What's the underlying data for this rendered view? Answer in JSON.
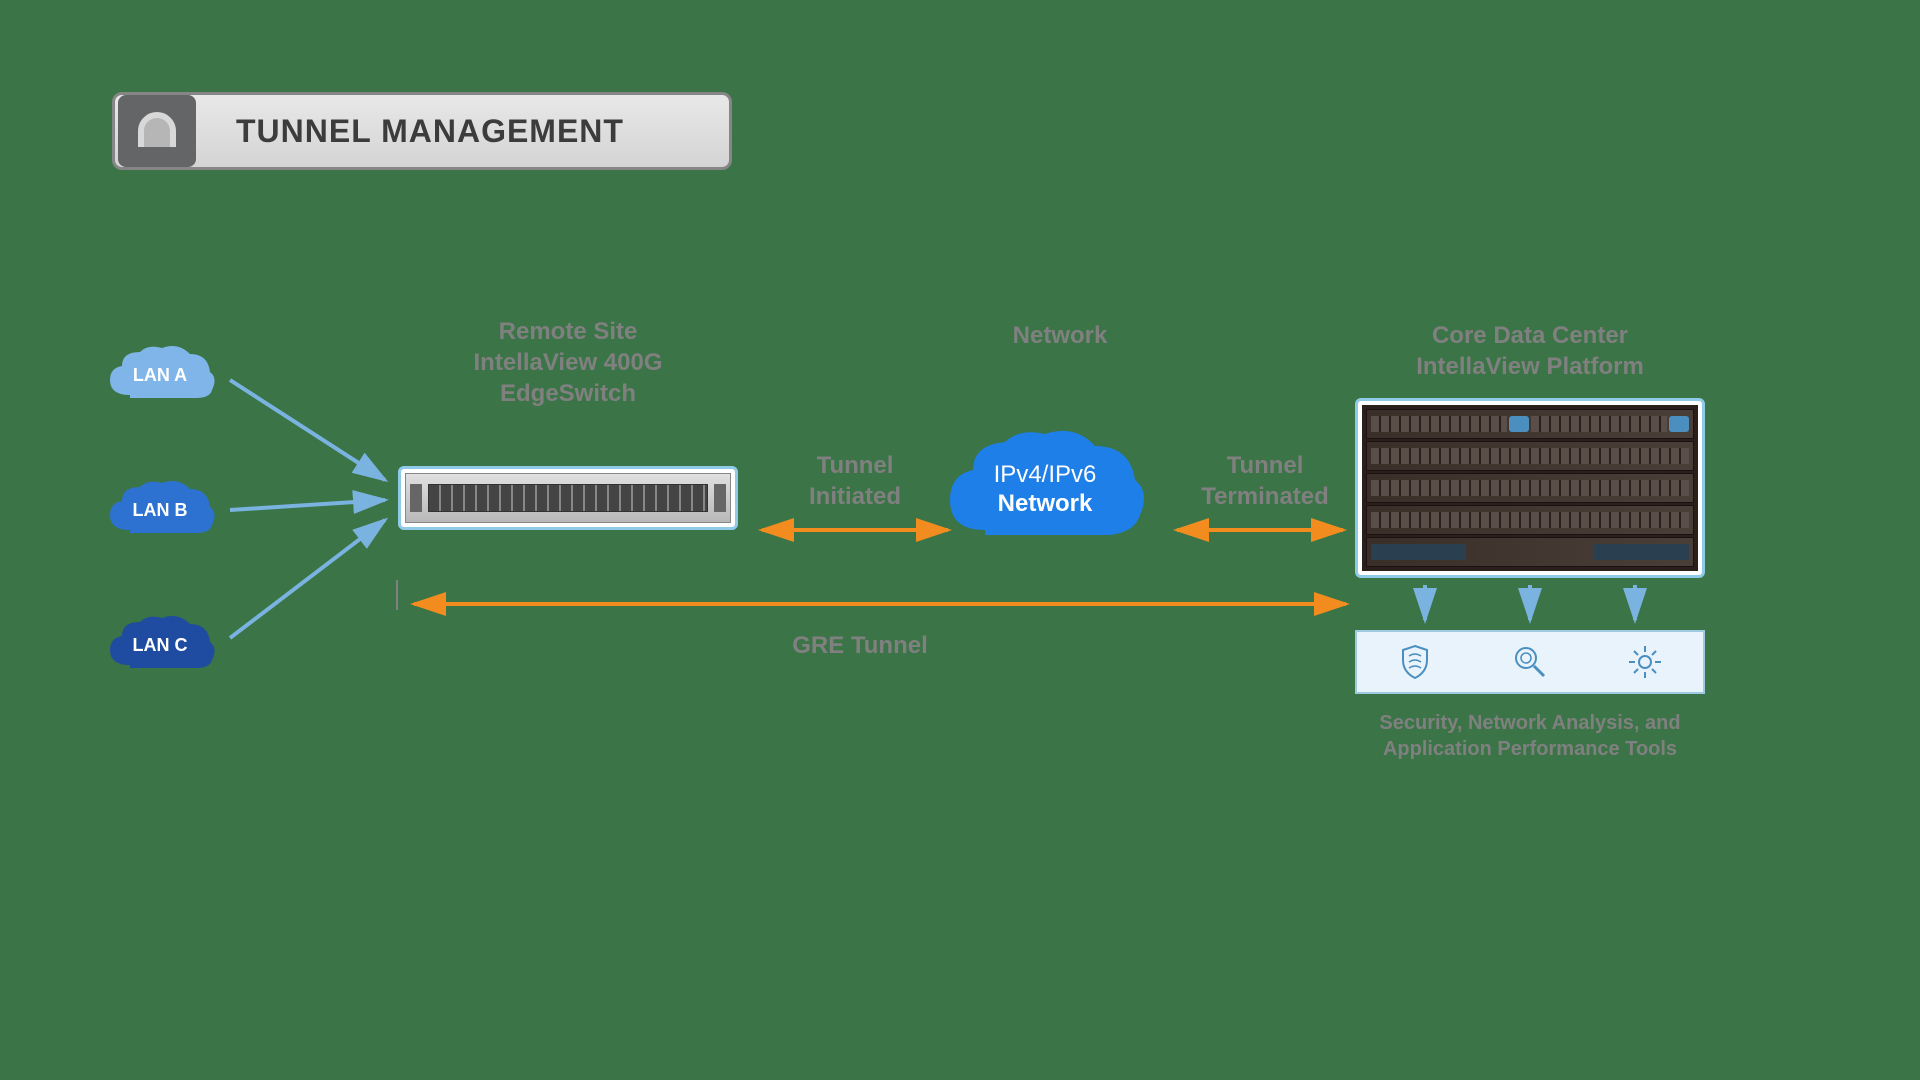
{
  "title": "TUNNEL MANAGEMENT",
  "lans": [
    {
      "label": "LAN A",
      "color": "#7fb5e8"
    },
    {
      "label": "LAN B",
      "color": "#2d72d0"
    },
    {
      "label": "LAN C",
      "color": "#1f4ba0"
    }
  ],
  "remote_site": {
    "line1": "Remote Site",
    "line2": "IntellaView 400G",
    "line3": "EdgeSwitch"
  },
  "network_section_label": "Network",
  "network_cloud": {
    "line1": "IPv4/IPv6",
    "line2": "Network",
    "color": "#1e7fe8"
  },
  "tunnel_initiated": "Tunnel\nInitiated",
  "tunnel_terminated": "Tunnel\nTerminated",
  "gre_tunnel": "GRE Tunnel",
  "core_data_center": {
    "line1": "Core Data Center",
    "line2": "IntellaView Platform"
  },
  "tools_label": "Security, Network Analysis, and Application Performance Tools",
  "colors": {
    "arrow_blue": "#7ab3e0",
    "arrow_orange": "#f28c1e",
    "label_gray": "#808080"
  }
}
